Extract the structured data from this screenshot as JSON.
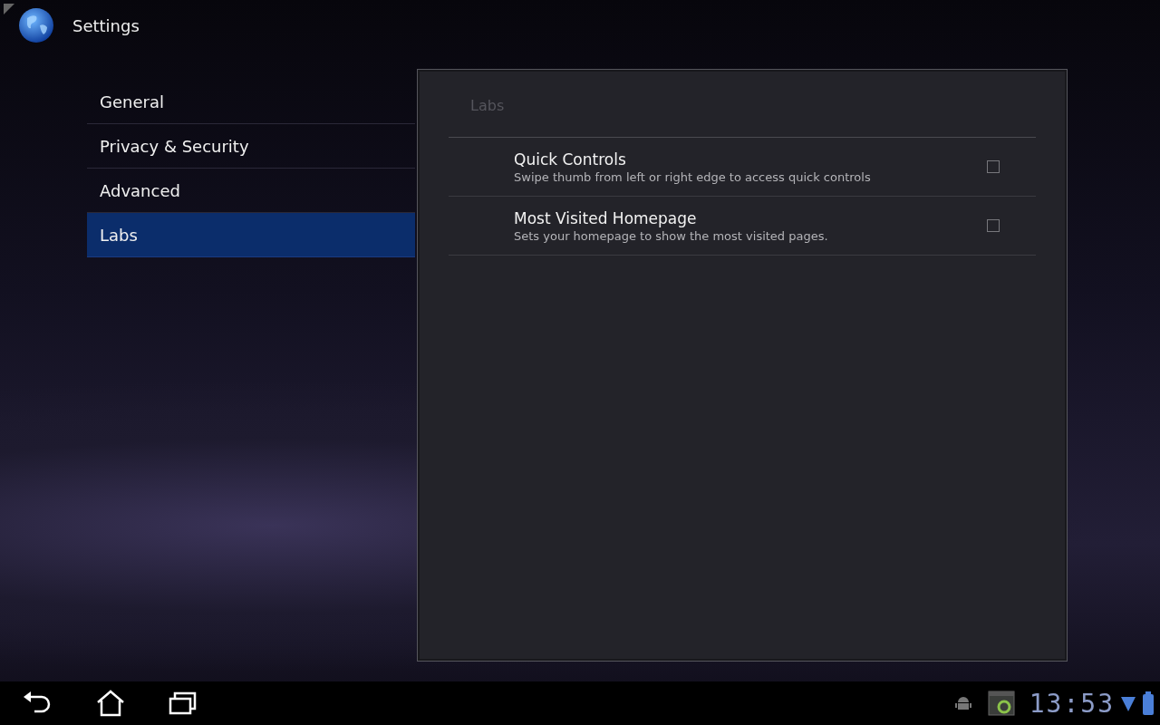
{
  "action_bar": {
    "title": "Settings"
  },
  "sidebar": {
    "items": [
      {
        "label": "General",
        "selected": false
      },
      {
        "label": "Privacy & Security",
        "selected": false
      },
      {
        "label": "Advanced",
        "selected": false
      },
      {
        "label": "Labs",
        "selected": true
      }
    ]
  },
  "panel": {
    "title": "Labs",
    "preferences": [
      {
        "title": "Quick Controls",
        "summary": "Swipe thumb from left or right edge to access quick controls",
        "checked": false
      },
      {
        "title": "Most Visited Homepage",
        "summary": "Sets your homepage to show the most visited pages.",
        "checked": false
      }
    ]
  },
  "status_bar": {
    "time": "13:53"
  }
}
